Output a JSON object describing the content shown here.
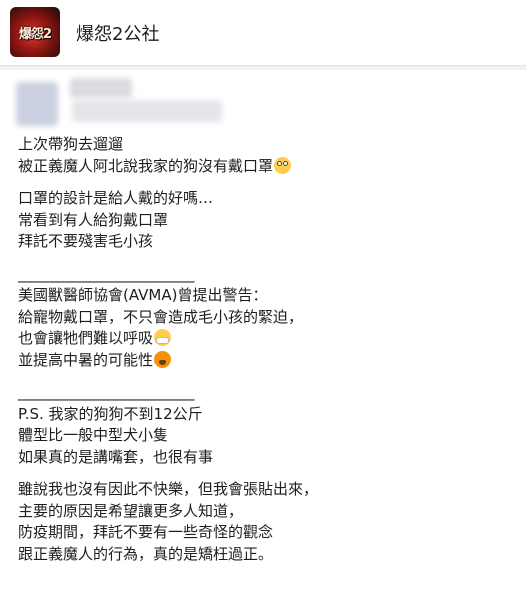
{
  "header": {
    "logo_text": "爆怨2",
    "page_name": "爆怨2公社"
  },
  "post": {
    "paragraphs": [
      [
        "上次帶狗去遛遛",
        "被正義魔人阿北說我家的狗沒有戴口罩"
      ],
      [
        "口罩的設計是給人戴的好嗎…",
        "常看到有人給狗戴口罩",
        "拜託不要殘害毛小孩"
      ],
      [
        "___________________________",
        "美國獸醫師協會(AVMA)曾提出警告：",
        "給寵物戴口罩，不只會造成毛小孩的緊迫，",
        "也會讓牠們難以呼吸",
        "並提高中暑的可能性"
      ],
      [
        "___________________________",
        "P.S. 我家的狗狗不到12公斤",
        "體型比一般中型犬小隻",
        "如果真的是講嘴套，也很有事"
      ],
      [
        "雖說我也沒有因此不快樂，但我會張貼出來，",
        "主要的原因是希望讓更多人知道，",
        "防疫期間，拜託不要有一些奇怪的觀念",
        "跟正義魔人的行為，真的是矯枉過正。"
      ]
    ],
    "emojis": [
      "eye-roll",
      "mask-face",
      "hot-face"
    ]
  }
}
